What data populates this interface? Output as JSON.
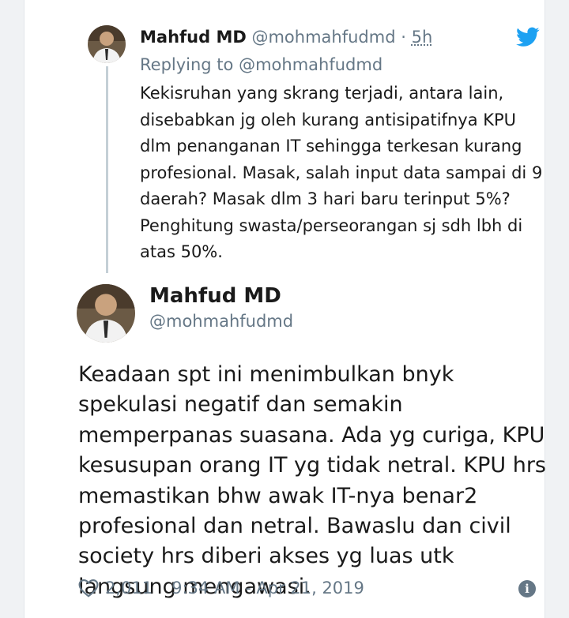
{
  "parent_tweet": {
    "author_name": "Mahfud MD",
    "author_handle": "@mohmahfudmd",
    "separator": "·",
    "relative_time": "5h",
    "replying_prefix": "Replying to",
    "replying_to": "@mohmahfudmd",
    "text": "Kekisruhan yang skrang terjadi, antara lain, disebabkan jg oleh kurang antisipatifnya KPU dlm penanganan IT sehingga terkesan kurang profesional. Masak, salah input data sampai di 9 daerah? Masak dlm 3 hari baru terinput 5%? Penghitung swasta/perseorangan sj sdh lbh di atas 50%."
  },
  "main_tweet": {
    "author_name": "Mahfud MD",
    "author_handle": "@mohmahfudmd",
    "text": "Keadaan spt ini menimbulkan bnyk spekulasi negatif dan semakin memperpanas suasana. Ada yg curiga, KPU kesusupan orang IT yg tidak netral. KPU hrs memastikan bhw awak IT-nya benar2 profesional dan netral. Bawaslu dan civil society hrs diberi akses yg luas utk langsung mengawasi.",
    "likes": "2,011",
    "timestamp": "9:34 AM - Apr 21, 2019"
  },
  "icons": {
    "brand": "twitter-bird-icon",
    "like": "heart-icon",
    "info": "info-icon"
  },
  "colors": {
    "twitter_blue": "#1da1f2",
    "secondary_text": "#657786",
    "thread_line": "#c4cfd6"
  }
}
